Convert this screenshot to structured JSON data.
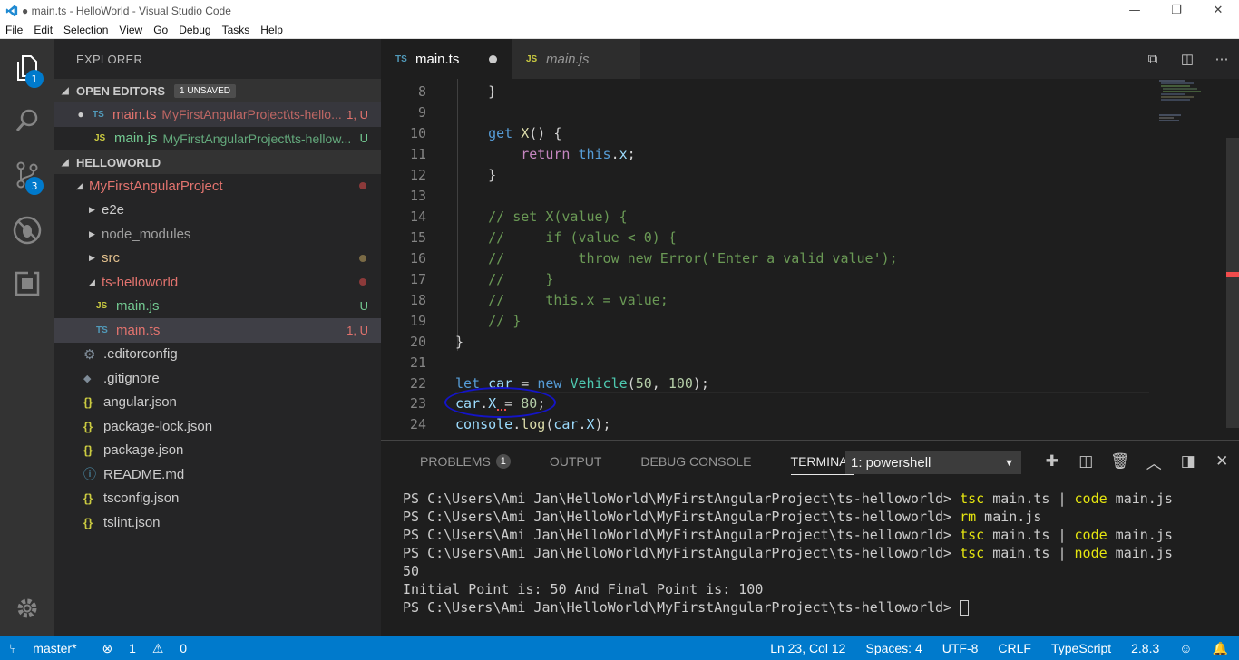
{
  "window": {
    "title": "● main.ts - HelloWorld - Visual Studio Code",
    "minimize": "—",
    "restore": "❐",
    "close": "✕"
  },
  "menu": [
    "File",
    "Edit",
    "Selection",
    "View",
    "Go",
    "Debug",
    "Tasks",
    "Help"
  ],
  "activity": {
    "explorer_badge": "1",
    "scm_badge": "3"
  },
  "sidebar": {
    "title": "EXPLORER",
    "open_editors": {
      "label": "OPEN EDITORS",
      "badge": "1 UNSAVED",
      "items": [
        {
          "type": "TS",
          "name": "main.ts",
          "path": "MyFirstAngularProject\\ts-hello...",
          "status": "1, U"
        },
        {
          "type": "JS",
          "name": "main.js",
          "path": "MyFirstAngularProject\\ts-hellow...",
          "status": "U"
        }
      ]
    },
    "workspace": {
      "label": "HELLOWORLD",
      "project": "MyFirstAngularProject",
      "folders": [
        "e2e",
        "node_modules",
        "src",
        "ts-helloworld"
      ],
      "ts_files": [
        {
          "type": "JS",
          "name": "main.js",
          "status": "U"
        },
        {
          "type": "TS",
          "name": "main.ts",
          "status": "1, U"
        }
      ],
      "root_files": [
        ".editorconfig",
        ".gitignore",
        "angular.json",
        "package-lock.json",
        "package.json",
        "README.md",
        "tsconfig.json",
        "tslint.json"
      ]
    }
  },
  "tabs": [
    {
      "type": "TS",
      "label": "main.ts"
    },
    {
      "type": "JS",
      "label": "main.js"
    }
  ],
  "editor": {
    "lines": [
      {
        "n": "8",
        "code": "    }"
      },
      {
        "n": "9",
        "code": ""
      },
      {
        "n": "10",
        "code": "    get X() {"
      },
      {
        "n": "11",
        "code": "        return this.x;"
      },
      {
        "n": "12",
        "code": "    }"
      },
      {
        "n": "13",
        "code": ""
      },
      {
        "n": "14",
        "code": "    // set X(value) {"
      },
      {
        "n": "15",
        "code": "    //     if (value < 0) {"
      },
      {
        "n": "16",
        "code": "    //         throw new Error('Enter a valid value');"
      },
      {
        "n": "17",
        "code": "    //     }"
      },
      {
        "n": "18",
        "code": "    //     this.x = value;"
      },
      {
        "n": "19",
        "code": "    // }"
      },
      {
        "n": "20",
        "code": "}"
      },
      {
        "n": "21",
        "code": ""
      },
      {
        "n": "22",
        "code": "let car = new Vehicle(50, 100);"
      },
      {
        "n": "23",
        "code": "car.X = 80;"
      },
      {
        "n": "24",
        "code": "console.log(car.X);"
      }
    ]
  },
  "panel": {
    "tabs": {
      "problems": "PROBLEMS",
      "problems_count": "1",
      "output": "OUTPUT",
      "debug": "DEBUG CONSOLE",
      "terminal": "TERMINAL"
    },
    "terminal_select": "1: powershell",
    "terminal": [
      {
        "prompt": "PS C:\\Users\\Ami Jan\\HelloWorld\\MyFirstAngularProject\\ts-helloworld> ",
        "cmd": "tsc",
        "rest": " main.ts | ",
        "cmd2": "code",
        "rest2": " main.js"
      },
      {
        "prompt": "PS C:\\Users\\Ami Jan\\HelloWorld\\MyFirstAngularProject\\ts-helloworld> ",
        "cmd": "rm",
        "rest": " main.js",
        "cmd2": "",
        "rest2": ""
      },
      {
        "prompt": "PS C:\\Users\\Ami Jan\\HelloWorld\\MyFirstAngularProject\\ts-helloworld> ",
        "cmd": "tsc",
        "rest": " main.ts | ",
        "cmd2": "code",
        "rest2": " main.js"
      },
      {
        "prompt": "PS C:\\Users\\Ami Jan\\HelloWorld\\MyFirstAngularProject\\ts-helloworld> ",
        "cmd": "tsc",
        "rest": " main.ts | ",
        "cmd2": "node",
        "rest2": " main.js"
      }
    ],
    "output_lines": [
      "50",
      "Initial Point is: 50 And Final Point is: 100"
    ],
    "last_prompt": "PS C:\\Users\\Ami Jan\\HelloWorld\\MyFirstAngularProject\\ts-helloworld> "
  },
  "status": {
    "branch": "master*",
    "errors": "1",
    "warnings": "0",
    "position": "Ln 23, Col 12",
    "spaces": "Spaces: 4",
    "encoding": "UTF-8",
    "eol": "CRLF",
    "language": "TypeScript",
    "version": "2.8.3"
  }
}
